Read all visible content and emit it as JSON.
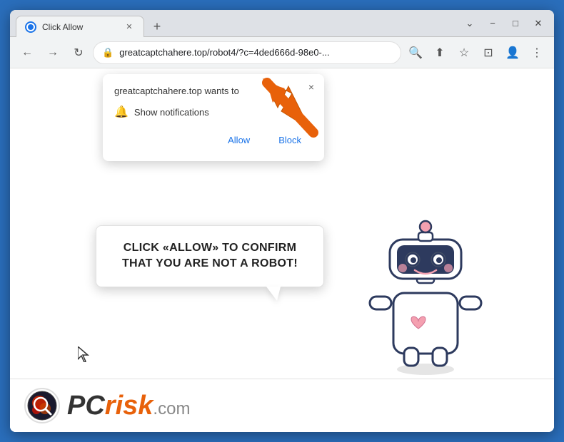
{
  "browser": {
    "window_title": "Click Allow",
    "tab": {
      "title": "Click Allow",
      "favicon_alt": "website-favicon"
    },
    "new_tab_button": "+",
    "window_controls": {
      "chevron_down": "⌄",
      "minimize": "−",
      "maximize": "□",
      "close": "✕"
    },
    "nav": {
      "back": "←",
      "forward": "→",
      "reload": "↻",
      "url": "greatcaptchahere.top/robot4/?c=4ded666d-98e0-...",
      "lock_icon": "🔒",
      "search_icon": "🔍",
      "share_icon": "⬆",
      "bookmark_icon": "☆",
      "split_icon": "⊡",
      "profile_icon": "👤",
      "menu_icon": "⋮"
    }
  },
  "notification_popup": {
    "header": "greatcaptchahere.top wants to",
    "bell_label": "Show notifications",
    "allow_button": "Allow",
    "block_button": "Block",
    "close_icon": "×"
  },
  "speech_bubble": {
    "text": "CLICK «ALLOW» TO CONFIRM THAT YOU ARE NOT A ROBOT!"
  },
  "pcrisk": {
    "logo_text_pc": "PC",
    "logo_text_risk": "risk",
    "logo_text_domain": ".com"
  },
  "colors": {
    "browser_border": "#2a6ebb",
    "arrow_color": "#e8610a",
    "accent_blue": "#1a73e8"
  }
}
